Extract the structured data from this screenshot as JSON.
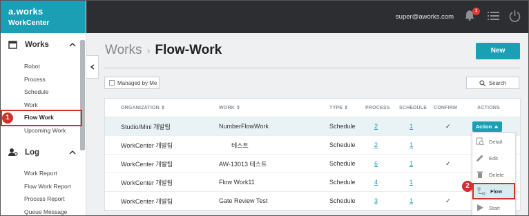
{
  "brand": {
    "logo": "a.works",
    "product": "WorkCenter"
  },
  "topbar": {
    "user_email": "super@aworks.com",
    "notification_count": "1"
  },
  "sidebar": {
    "sections": [
      {
        "label": "Works",
        "icon": "calendar-icon"
      },
      {
        "label": "Log",
        "icon": "user-settings-icon"
      }
    ],
    "works_items": [
      "Robot",
      "Process",
      "Schedule",
      "Work",
      "Flow Work",
      "Upcoming Work"
    ],
    "log_items": [
      "Work Report",
      "Flow Work Report",
      "Process Report",
      "Queue Message"
    ],
    "active_item": "Flow Work"
  },
  "page": {
    "crumb": "Works",
    "title": "Flow-Work",
    "new_label": "New"
  },
  "filters": {
    "managed_label": "Managed by Me",
    "search_label": "Search"
  },
  "table": {
    "headers": {
      "org": "ORGANIZATION",
      "work": "WORK",
      "type": "TYPE",
      "process": "PROCESS",
      "schedule": "SCHEDULE",
      "confirm": "CONFIRM",
      "actions": "ACTIONS"
    },
    "sort_glyph": "⇕",
    "rows": [
      {
        "org": "Studio/Mini 개발팀",
        "work": "NumberFlowWork",
        "type": "Schedule",
        "process": "2",
        "schedule": "1",
        "confirm": "✓",
        "action": "Action"
      },
      {
        "org": "WorkCenter 개발팀",
        "work": "테스트",
        "type": "Schedule",
        "process": "2",
        "schedule": "1",
        "confirm": "",
        "action": ""
      },
      {
        "org": "WorkCenter 개발팀",
        "work": "AW-13013 테스트",
        "type": "Schedule",
        "process": "6",
        "schedule": "1",
        "confirm": "✓",
        "action": ""
      },
      {
        "org": "WorkCenter 개발팀",
        "work": "Flow Work11",
        "type": "Schedule",
        "process": "4",
        "schedule": "1",
        "confirm": "",
        "action": ""
      },
      {
        "org": "WorkCenter 개발팀",
        "work": "Gate Review Test",
        "type": "Schedule",
        "process": "3",
        "schedule": "1",
        "confirm": "✓",
        "action": ""
      }
    ]
  },
  "action_menu": {
    "items": [
      "Detail",
      "Edit",
      "Delete",
      "Flow",
      "Start"
    ],
    "highlighted": "Flow"
  },
  "callouts": {
    "marker1": "1",
    "marker2": "2"
  },
  "colors": {
    "accent": "#1a9fb4",
    "callout": "#d32f2f",
    "topbar": "#2c2e32"
  }
}
